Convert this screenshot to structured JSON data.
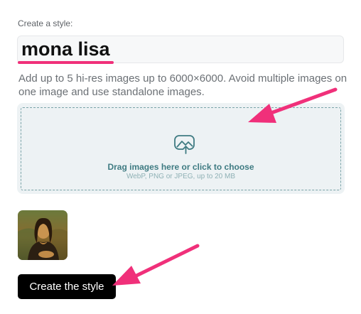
{
  "form": {
    "section_label": "Create a style:",
    "name_value": "mona lisa",
    "hint": "Add up to 5 hi-res images up to 6000×6000. Avoid multiple images on one image and use standalone images."
  },
  "dropzone": {
    "title": "Drag images here or click to choose",
    "subtitle": "WebP, PNG or JPEG, up to 20 MB",
    "icon": "image-upload-icon"
  },
  "uploads": [
    {
      "kind": "thumbnail",
      "subject": "Mona Lisa painting"
    }
  ],
  "actions": {
    "create_label": "Create the style"
  },
  "annotations": {
    "highlight_color": "#f0307a",
    "accent_teal": "#3f7b82"
  }
}
